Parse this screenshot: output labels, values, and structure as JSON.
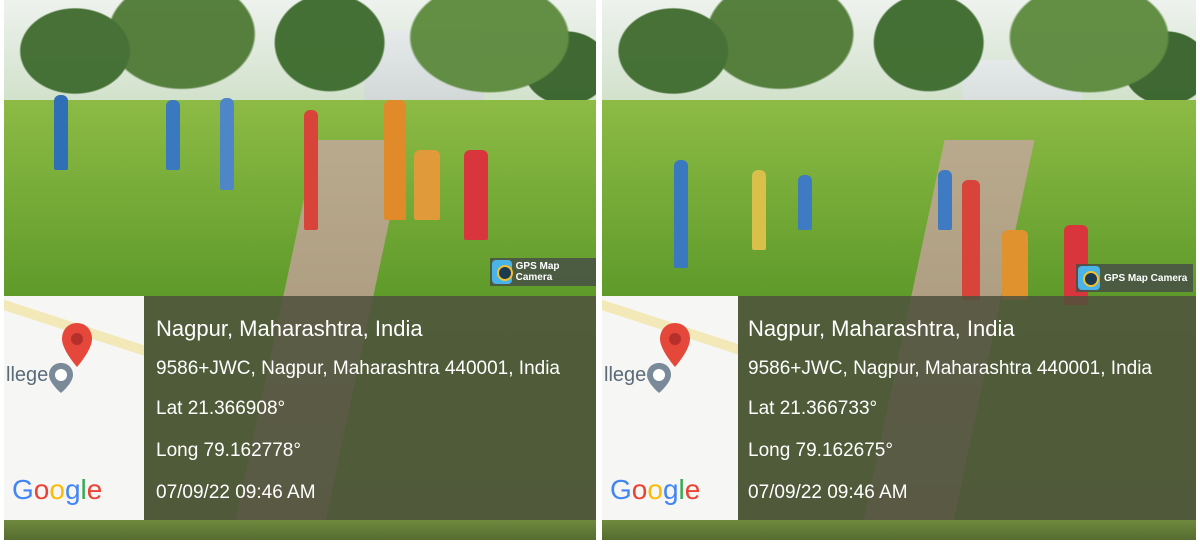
{
  "photos": [
    {
      "badge": "GPS Map Camera",
      "map": {
        "partial_label": "llege",
        "logo_text": [
          "G",
          "o",
          "o",
          "g",
          "l",
          "e"
        ]
      },
      "location_title": "Nagpur, Maharashtra, India",
      "address": "9586+JWC, Nagpur, Maharashtra 440001, India",
      "lat": "Lat 21.366908°",
      "long": "Long 79.162778°",
      "datetime": "07/09/22 09:46 AM"
    },
    {
      "badge": "GPS Map Camera",
      "map": {
        "partial_label": "llege",
        "logo_text": [
          "G",
          "o",
          "o",
          "g",
          "l",
          "e"
        ]
      },
      "location_title": "Nagpur, Maharashtra, India",
      "address": "9586+JWC, Nagpur, Maharashtra 440001, India",
      "lat": "Lat 21.366733°",
      "long": "Long 79.162675°",
      "datetime": "07/09/22 09:46 AM"
    }
  ],
  "icons": {
    "pin": "map-pin-icon",
    "place": "place-marker-icon",
    "gps": "gps-map-camera-icon"
  },
  "colors": {
    "pin_red": "#e5483a",
    "panel": "#4e523c",
    "google_blue": "#4285f4",
    "google_red": "#ea4335",
    "google_yellow": "#fbbc05",
    "google_green": "#34a853"
  }
}
